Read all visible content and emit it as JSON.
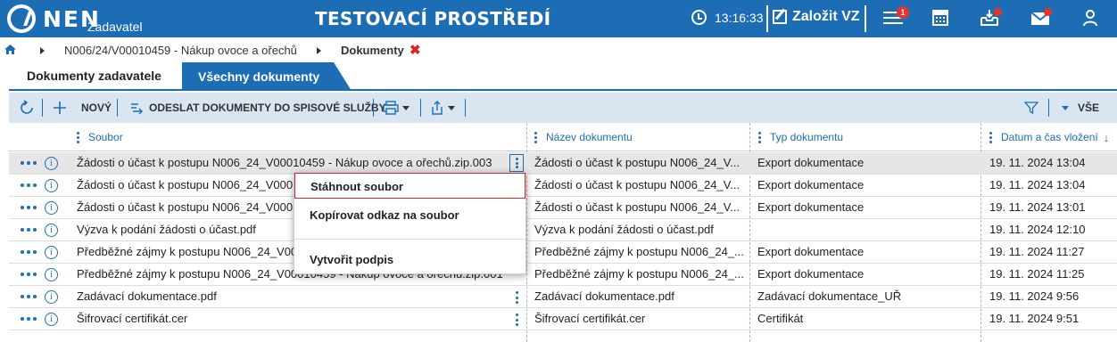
{
  "header": {
    "logo_text": "NEN",
    "logo_sub": "Zadavatel",
    "env_title": "TESTOVACÍ PROSTŘEDÍ",
    "clock": "13:16:33",
    "create_label": "Založit VZ",
    "menu_badge": "1"
  },
  "breadcrumb": {
    "path": "N006/24/V00010459 - Nákup ovoce a ořechů",
    "current": "Dokumenty",
    "close": "✖"
  },
  "tabs": {
    "active": "Dokumenty zadavatele",
    "other": "Všechny dokumenty"
  },
  "toolbar": {
    "new_label": "NOVÝ",
    "send_label": "ODESLAT DOKUMENTY DO SPISOVÉ SLUŽBY",
    "filter_all": "VŠE"
  },
  "columns": {
    "file": "Soubor",
    "name": "Název dokumentu",
    "type": "Typ dokumentu",
    "date": "Datum a čas vložení",
    "sort_arrow": "↓"
  },
  "rows": [
    {
      "file": "Žádosti o účast k postupu N006_24_V00010459 - Nákup ovoce a ořechů.zip.003",
      "name": "Žádosti o účast k postupu N006_24_V...",
      "type": "Export dokumentace",
      "date": "19. 11. 2024 13:04"
    },
    {
      "file": "Žádosti o účast k postupu N006_24_V00010459 - Nákup ovoce a ořechů.zip.002",
      "name": "Žádosti o účast k postupu N006_24_V...",
      "type": "Export dokumentace",
      "date": "19. 11. 2024 13:04"
    },
    {
      "file": "Žádosti o účast k postupu N006_24_V00010459 - Nákup ovoce a ořechů.zip.001",
      "name": "Žádosti o účast k postupu N006_24_V...",
      "type": "Export dokumentace",
      "date": "19. 11. 2024 13:01"
    },
    {
      "file": "Výzva k podání žádosti o účast.pdf",
      "name": "Výzva k podání žádosti o účast.pdf",
      "type": "",
      "date": "19. 11. 2024 12:10"
    },
    {
      "file": "Předběžné zájmy k postupu N006_24_V00010459 - Nákup ovoce a ořechů.zip.002",
      "name": "Předběžné zájmy k postupu N006_24_...",
      "type": "Export dokumentace",
      "date": "19. 11. 2024 11:27"
    },
    {
      "file": "Předběžné zájmy k postupu N006_24_V00010459 - Nákup ovoce a ořechů.zip.001",
      "name": "Předběžné zájmy k postupu N006_24_...",
      "type": "Export dokumentace",
      "date": "19. 11. 2024 11:25"
    },
    {
      "file": "Zadávací dokumentace.pdf",
      "name": "Zadávací dokumentace.pdf",
      "type": "Zadávací dokumentace_UŘ",
      "date": "19. 11. 2024 9:56"
    },
    {
      "file": "Šifrovací certifikát.cer",
      "name": "Šifrovací certifikát.cer",
      "type": "Certifikát",
      "date": "19. 11. 2024 9:51"
    }
  ],
  "context_menu": {
    "download": "Stáhnout soubor",
    "copy_link": "Kopírovat odkaz na soubor",
    "sign": "Vytvořit podpis"
  },
  "colors": {
    "brand_blue": "#1d6db5",
    "toolbar_bg": "#d9e5f0",
    "alert_red": "#e8322c"
  }
}
